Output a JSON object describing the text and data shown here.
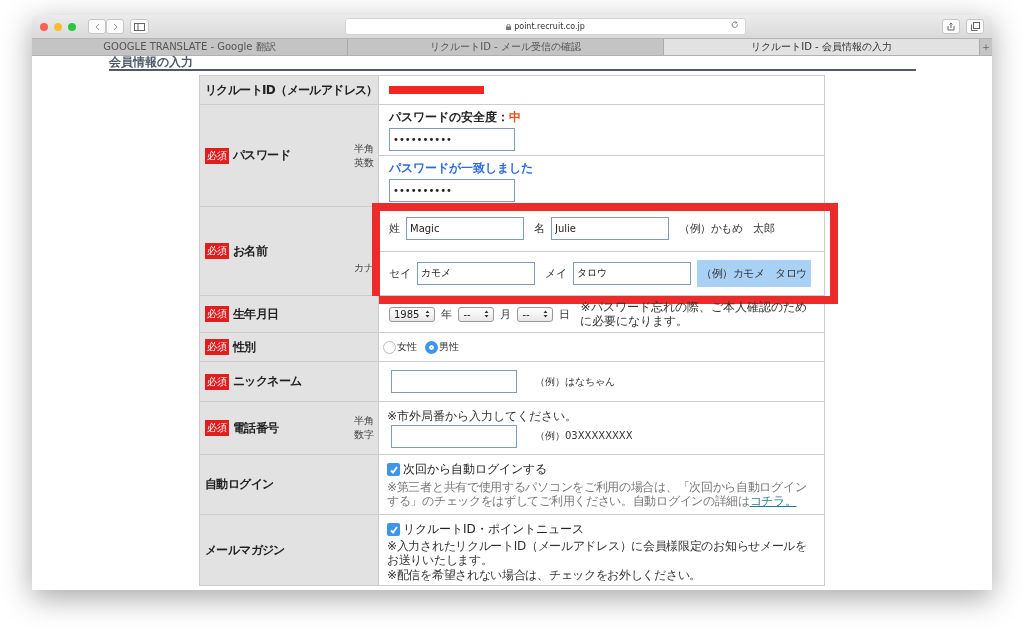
{
  "browser": {
    "url": "point.recruit.co.jp",
    "tabs": [
      {
        "label": "GOOGLE TRANSLATE - Google 翻訳",
        "selected": false
      },
      {
        "label": "リクルートID - メール受信の確認",
        "selected": false
      },
      {
        "label": "リクルートID - 会員情報の入力",
        "selected": true
      }
    ],
    "new_tab": "+"
  },
  "page": {
    "heading": "会員情報の入力"
  },
  "rows": [
    {
      "kind": "id",
      "label": "リクルートID（メールアドレス）",
      "redacted": true
    },
    {
      "kind": "password",
      "label": "パスワード",
      "badge": "必須",
      "note": [
        "半角",
        "英数"
      ],
      "strength_label": "パスワードの安全度：",
      "strength": "中",
      "password": "••••••••••",
      "match_message": "パスワードが一致しました",
      "confirm": "••••••••••"
    },
    {
      "kind": "name",
      "label": "お名前",
      "badge": "必須",
      "note": [
        "カナ"
      ],
      "annotated": true,
      "lines": [
        {
          "fields": [
            {
              "label": "姓",
              "value": "Magic"
            },
            {
              "label": "名",
              "value": "Julie"
            }
          ],
          "example": "（例）かもめ　太郎",
          "highlighted": false
        },
        {
          "fields": [
            {
              "label": "セイ",
              "value": "カモメ"
            },
            {
              "label": "メイ",
              "value": "タロウ"
            }
          ],
          "example": "（例）カモメ　タロウ",
          "highlighted": true
        }
      ]
    },
    {
      "kind": "date",
      "label": "生年月日",
      "badge": "必須",
      "selects": [
        {
          "value": "1985",
          "unit": "年"
        },
        {
          "value": "--",
          "unit": "月"
        },
        {
          "value": "--",
          "unit": "日"
        }
      ],
      "hint": "※パスワード忘れの際、ご本人確認のために必要になります。"
    },
    {
      "kind": "gender",
      "label": "性別",
      "badge": "必須",
      "options": [
        {
          "label": "女性",
          "selected": false
        },
        {
          "label": "男性",
          "selected": true
        }
      ]
    },
    {
      "kind": "nickname",
      "label": "ニックネーム",
      "badge": "必須",
      "example": "（例）はなちゃん"
    },
    {
      "kind": "phone",
      "label": "電話番号",
      "badge": "必須",
      "note": [
        "半角",
        "数字"
      ],
      "hint": "※市外局番から入力してください。",
      "example": "（例）03XXXXXXXX"
    },
    {
      "kind": "autologin",
      "label": "自動ログイン",
      "checkbox": {
        "label": "次回から自動ログインする",
        "checked": true
      },
      "text": "※第三者と共有で使用するパソコンをご利用の場合は、「次回から自動ログインする」のチェックをはずしてご利用ください。自動ログインの詳細は",
      "link": "コチラ。"
    },
    {
      "kind": "mail",
      "label": "メールマガジン",
      "checkbox": {
        "label": "リクルートID・ポイントニュース",
        "checked": true
      },
      "notes": [
        "※入力されたリクルートID（メールアドレス）に会員様限定のお知らせメールをお送りいたします。",
        "※配信を希望されない場合は、チェックをお外しください。"
      ]
    }
  ]
}
